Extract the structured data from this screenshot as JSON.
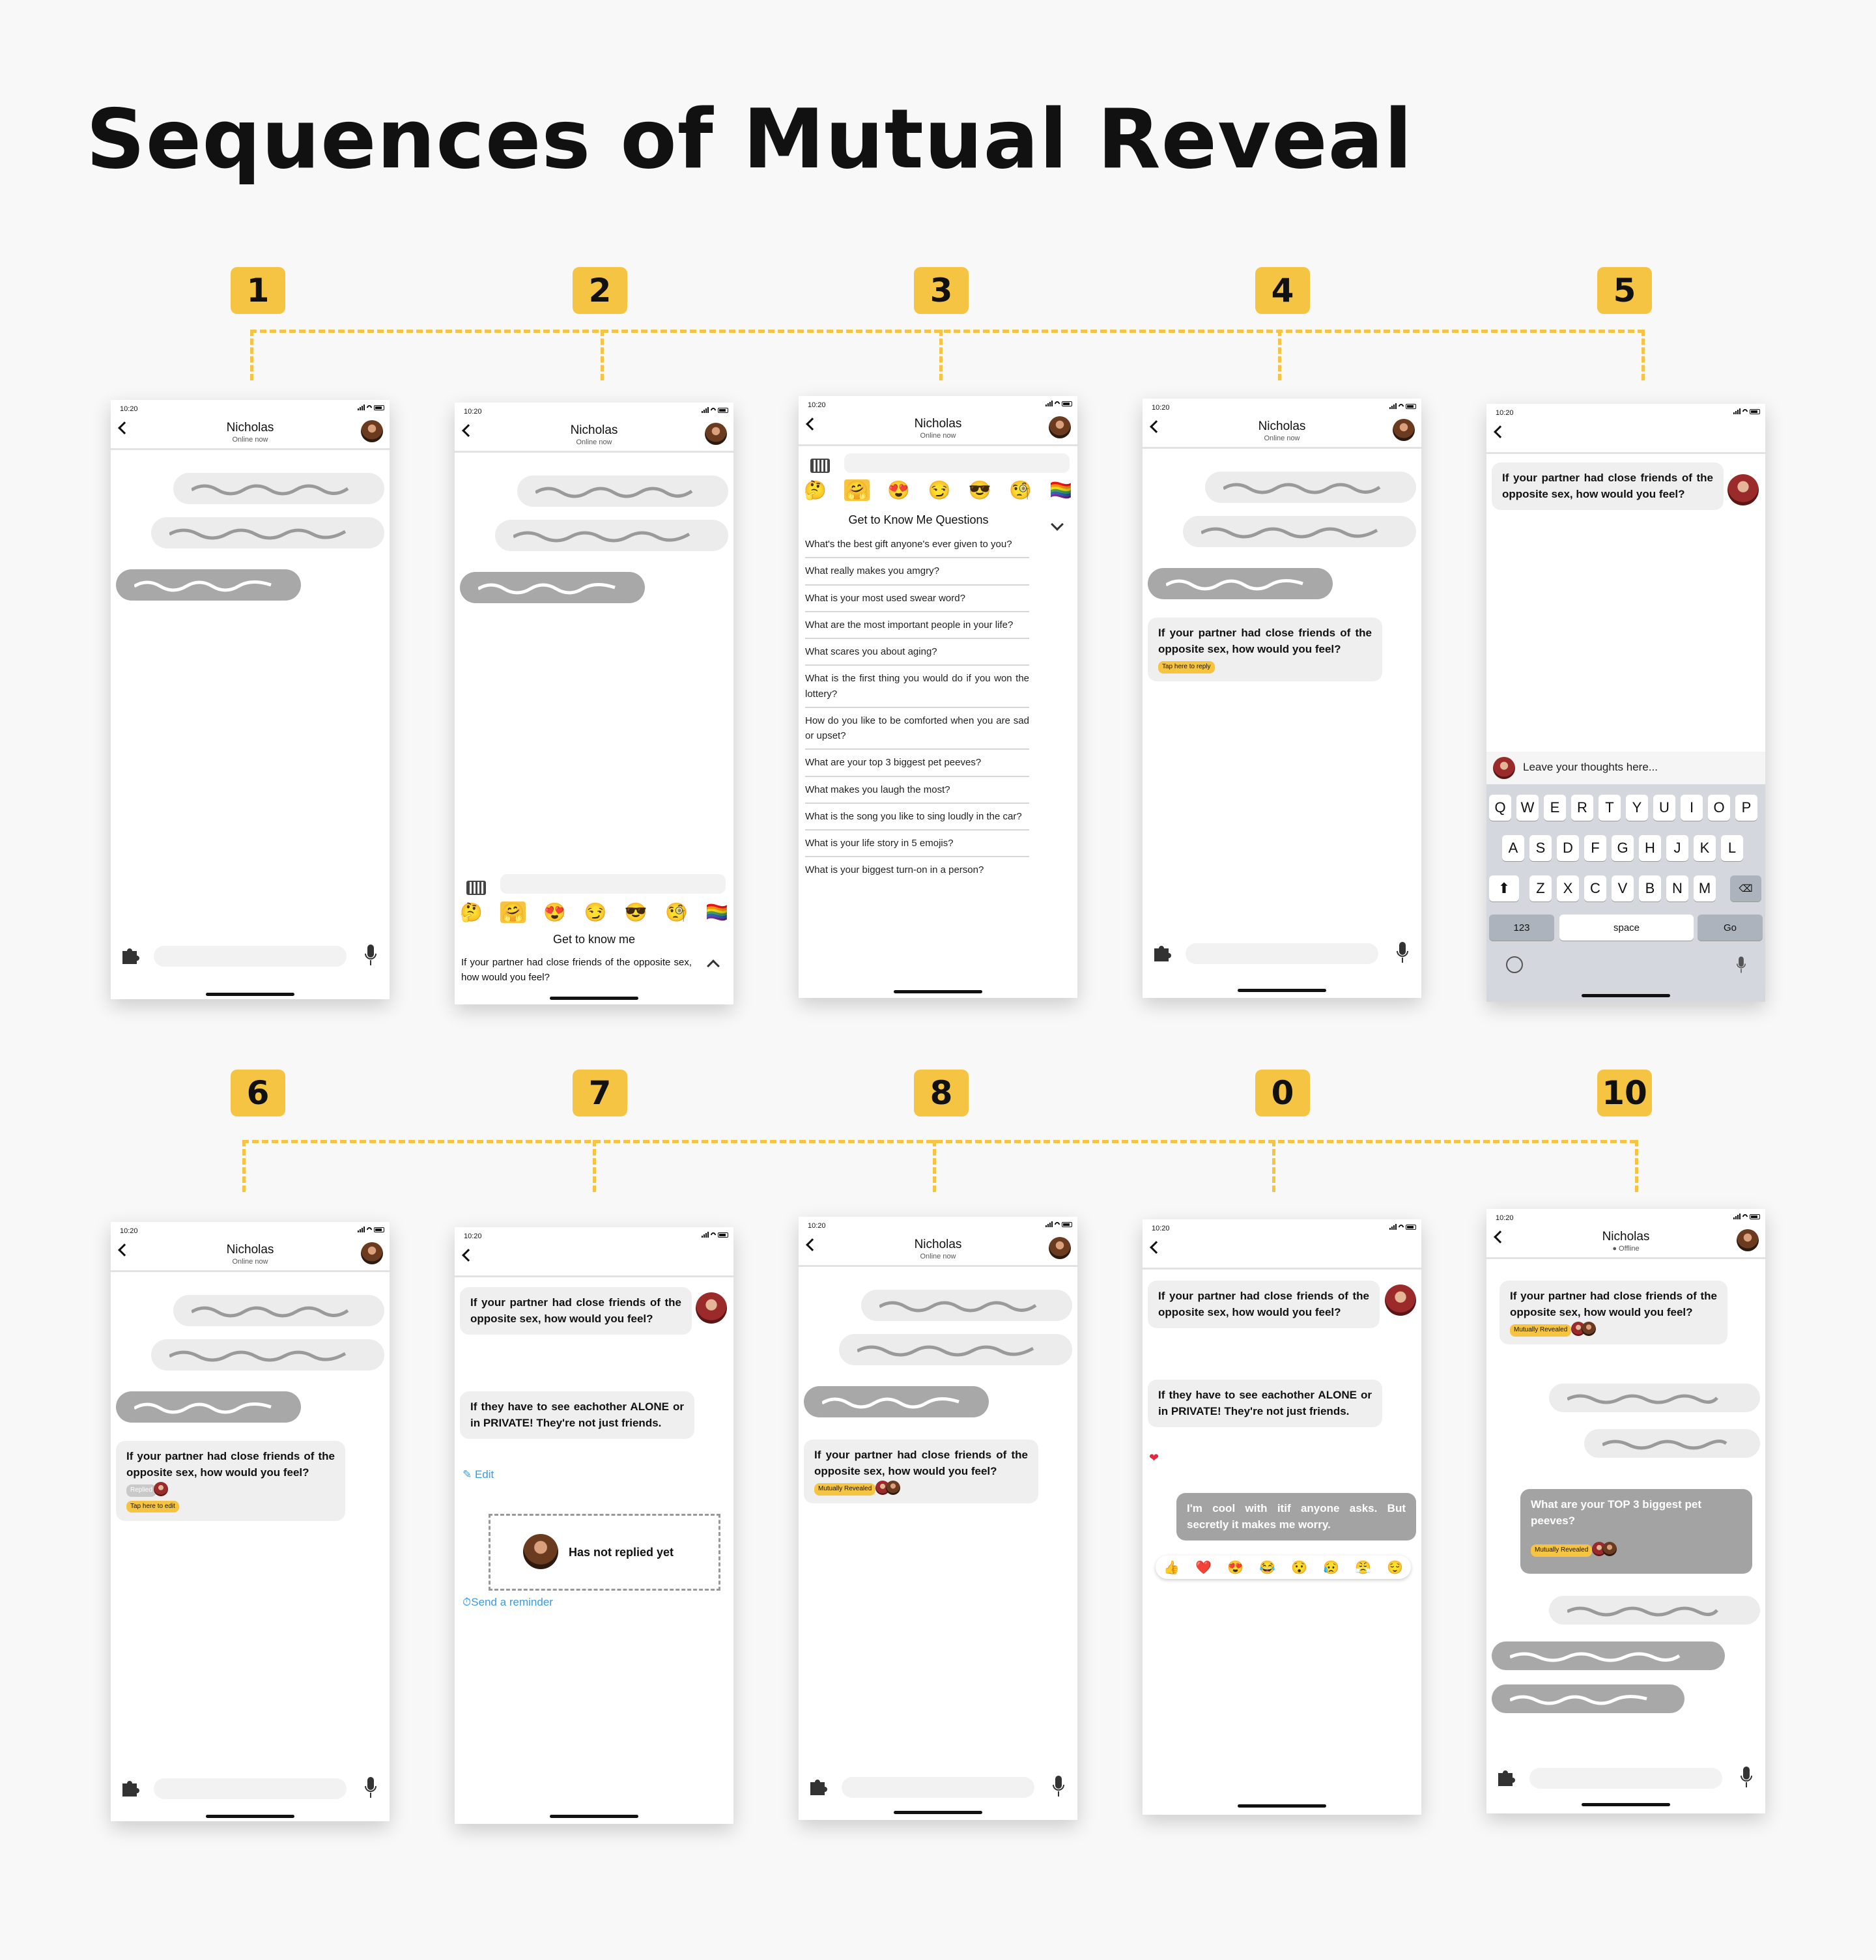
{
  "title": "Sequences of Mutual Reveal",
  "steps": [
    "1",
    "2",
    "3",
    "4",
    "5",
    "6",
    "7",
    "8",
    "0",
    "10"
  ],
  "colors": {
    "accent": "#f6c443",
    "bubble": "#efefef",
    "bubble_dark": "#a3a3a3",
    "link": "#3a9be0"
  },
  "status_time": "10:20",
  "contact": {
    "name": "Nicholas",
    "status_online": "Online now",
    "status_offline": "Offline"
  },
  "question": "If your partner had close friends of the opposite sex, how would you feel?",
  "reply_text": "If they have to see eachother ALONE or in PRIVATE! They're not just friends.",
  "partner_reply": "I'm cool with itif anyone asks. But secretly it makes me worry.",
  "pet_peeves": "What are your TOP 3 biggest pet peeves?",
  "tags": {
    "tap_reply": "Tap here to reply",
    "tap_edit": "Tap here to edit",
    "replied": "Replied",
    "mutual": "Mutually Revealed"
  },
  "panel": {
    "get_to_know": "Get to know me",
    "get_to_know_q": "Get to Know Me Questions"
  },
  "questions": [
    "What's the best gift anyone's ever given to you?",
    "What really makes you amgry?",
    "What is your most used swear word?",
    "What are the most important people in your life?",
    "What scares you about aging?",
    "What is the first thing you would do if you won the lottery?",
    "How do you like to be comforted when you are sad or upset?",
    "What are your top 3 biggest pet peeves?",
    "What makes you laugh the most?",
    "What is the song you like to sing loudly in the car?",
    "What is your life story in 5 emojis?",
    "What is your biggest turn-on in a person?"
  ],
  "emoji_strip": [
    "🤔",
    "🤗",
    "😍",
    "😏",
    "😎",
    "🧐",
    "🏳️‍🌈"
  ],
  "reactions": [
    "👍",
    "❤️",
    "😍",
    "😂",
    "😯",
    "😥",
    "😤",
    "😌"
  ],
  "input_placeholder": "Leave your thoughts here...",
  "keyboard": {
    "row1": [
      "Q",
      "W",
      "E",
      "R",
      "T",
      "Y",
      "U",
      "I",
      "O",
      "P"
    ],
    "row2": [
      "A",
      "S",
      "D",
      "F",
      "G",
      "H",
      "J",
      "K",
      "L"
    ],
    "row3": [
      "Z",
      "X",
      "C",
      "V",
      "B",
      "N",
      "M"
    ],
    "num": "123",
    "space": "space",
    "go": "Go"
  },
  "edit": "Edit",
  "not_replied": "Has not replied yet",
  "send_reminder": "Send a reminder"
}
